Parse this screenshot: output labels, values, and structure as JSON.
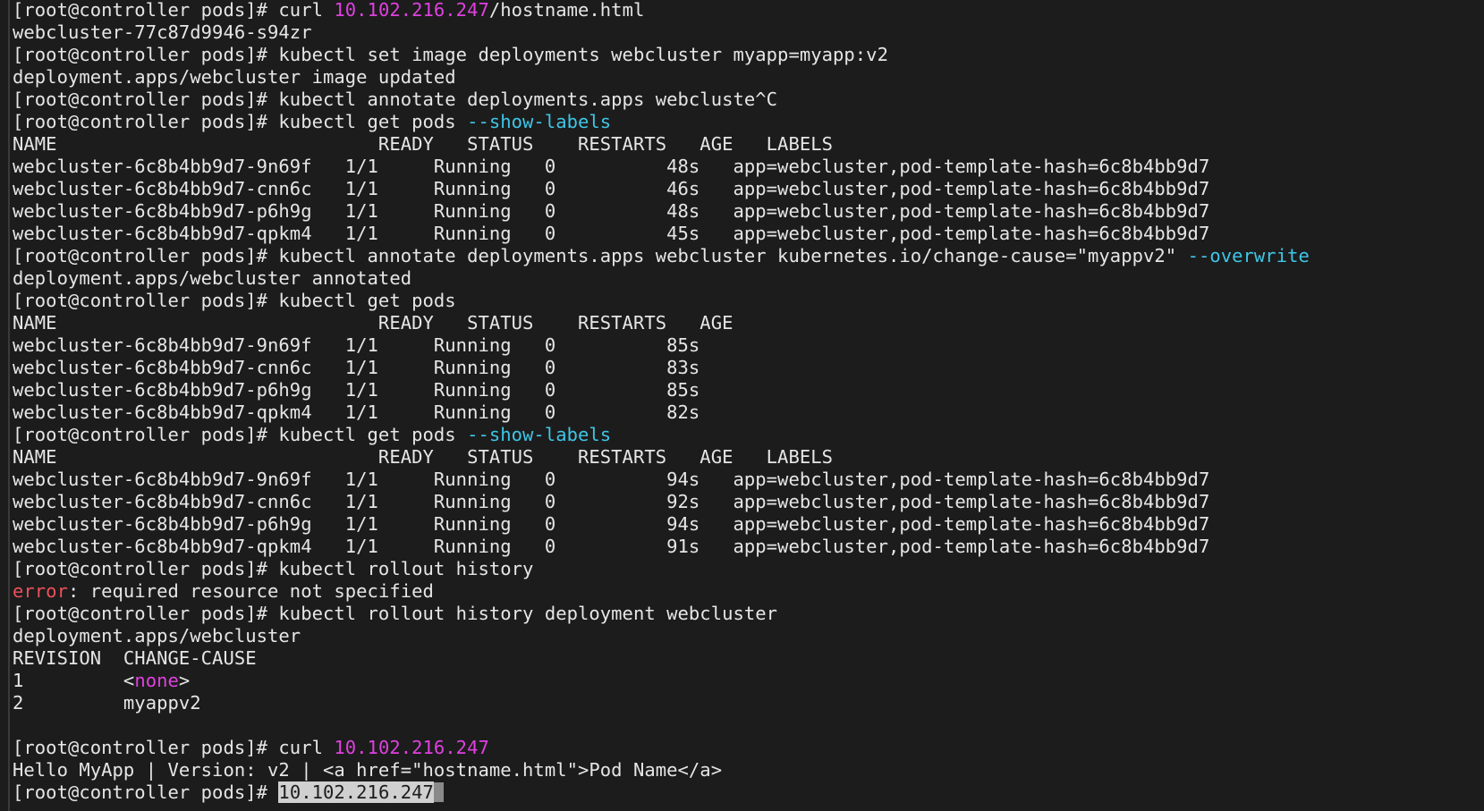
{
  "colors": {
    "background": "#1c1c1c",
    "text": "#e6e6e6",
    "ip_highlight": "#e040e0",
    "flag_highlight": "#3ec6e6",
    "error": "#f0505a",
    "selection": "#d0d0d0"
  },
  "terminal": {
    "lines": [
      {
        "segments": [
          {
            "t": "[root@controller pods]# curl "
          },
          {
            "t": "10.102.216.247",
            "c": "magenta"
          },
          {
            "t": "/hostname.html"
          }
        ]
      },
      {
        "segments": [
          {
            "t": "webcluster-77c87d9946-s94zr"
          }
        ]
      },
      {
        "segments": [
          {
            "t": "[root@controller pods]# kubectl set image deployments webcluster myapp=myapp:v2"
          }
        ]
      },
      {
        "segments": [
          {
            "t": "deployment.apps/webcluster image updated"
          }
        ]
      },
      {
        "segments": [
          {
            "t": "[root@controller pods]# kubectl annotate deployments.apps webcluste^C"
          }
        ]
      },
      {
        "segments": [
          {
            "t": "[root@controller pods]# kubectl get pods "
          },
          {
            "t": "--show-labels",
            "c": "cyan"
          }
        ]
      },
      {
        "segments": [
          {
            "t": "NAME                             READY   STATUS    RESTARTS   AGE   LABELS"
          }
        ]
      },
      {
        "segments": [
          {
            "t": "webcluster-6c8b4bb9d7-9n69f   1/1     Running   0          48s   app=webcluster,pod-template-hash=6c8b4bb9d7"
          }
        ]
      },
      {
        "segments": [
          {
            "t": "webcluster-6c8b4bb9d7-cnn6c   1/1     Running   0          46s   app=webcluster,pod-template-hash=6c8b4bb9d7"
          }
        ]
      },
      {
        "segments": [
          {
            "t": "webcluster-6c8b4bb9d7-p6h9g   1/1     Running   0          48s   app=webcluster,pod-template-hash=6c8b4bb9d7"
          }
        ]
      },
      {
        "segments": [
          {
            "t": "webcluster-6c8b4bb9d7-qpkm4   1/1     Running   0          45s   app=webcluster,pod-template-hash=6c8b4bb9d7"
          }
        ]
      },
      {
        "segments": [
          {
            "t": "[root@controller pods]# kubectl annotate deployments.apps webcluster kubernetes.io/change-cause=\"myappv2\" "
          },
          {
            "t": "--overwrite",
            "c": "cyan"
          }
        ]
      },
      {
        "segments": [
          {
            "t": "deployment.apps/webcluster annotated"
          }
        ]
      },
      {
        "segments": [
          {
            "t": "[root@controller pods]# kubectl get pods"
          }
        ]
      },
      {
        "segments": [
          {
            "t": "NAME                             READY   STATUS    RESTARTS   AGE"
          }
        ]
      },
      {
        "segments": [
          {
            "t": "webcluster-6c8b4bb9d7-9n69f   1/1     Running   0          85s"
          }
        ]
      },
      {
        "segments": [
          {
            "t": "webcluster-6c8b4bb9d7-cnn6c   1/1     Running   0          83s"
          }
        ]
      },
      {
        "segments": [
          {
            "t": "webcluster-6c8b4bb9d7-p6h9g   1/1     Running   0          85s"
          }
        ]
      },
      {
        "segments": [
          {
            "t": "webcluster-6c8b4bb9d7-qpkm4   1/1     Running   0          82s"
          }
        ]
      },
      {
        "segments": [
          {
            "t": "[root@controller pods]# kubectl get pods "
          },
          {
            "t": "--show-labels",
            "c": "cyan"
          }
        ]
      },
      {
        "segments": [
          {
            "t": "NAME                             READY   STATUS    RESTARTS   AGE   LABELS"
          }
        ]
      },
      {
        "segments": [
          {
            "t": "webcluster-6c8b4bb9d7-9n69f   1/1     Running   0          94s   app=webcluster,pod-template-hash=6c8b4bb9d7"
          }
        ]
      },
      {
        "segments": [
          {
            "t": "webcluster-6c8b4bb9d7-cnn6c   1/1     Running   0          92s   app=webcluster,pod-template-hash=6c8b4bb9d7"
          }
        ]
      },
      {
        "segments": [
          {
            "t": "webcluster-6c8b4bb9d7-p6h9g   1/1     Running   0          94s   app=webcluster,pod-template-hash=6c8b4bb9d7"
          }
        ]
      },
      {
        "segments": [
          {
            "t": "webcluster-6c8b4bb9d7-qpkm4   1/1     Running   0          91s   app=webcluster,pod-template-hash=6c8b4bb9d7"
          }
        ]
      },
      {
        "segments": [
          {
            "t": "[root@controller pods]# kubectl rollout history"
          }
        ]
      },
      {
        "segments": [
          {
            "t": "error",
            "c": "red"
          },
          {
            "t": ": required resource not specified"
          }
        ]
      },
      {
        "segments": [
          {
            "t": "[root@controller pods]# kubectl rollout history deployment webcluster"
          }
        ]
      },
      {
        "segments": [
          {
            "t": "deployment.apps/webcluster"
          }
        ]
      },
      {
        "segments": [
          {
            "t": "REVISION  CHANGE-CAUSE"
          }
        ]
      },
      {
        "segments": [
          {
            "t": "1         <"
          },
          {
            "t": "none",
            "c": "magenta"
          },
          {
            "t": ">"
          }
        ]
      },
      {
        "segments": [
          {
            "t": "2         myappv2"
          }
        ]
      },
      {
        "segments": [
          {
            "t": ""
          }
        ]
      },
      {
        "segments": [
          {
            "t": "[root@controller pods]# curl "
          },
          {
            "t": "10.102.216.247",
            "c": "magenta"
          }
        ]
      },
      {
        "segments": [
          {
            "t": "Hello MyApp | Version: v2 | <a href=\"hostname.html\">Pod Name</a>"
          }
        ]
      },
      {
        "segments": [
          {
            "t": "[root@controller pods]# "
          },
          {
            "t": "10.102.216.247",
            "c": "selected"
          },
          {
            "t": "",
            "c": "cursor"
          }
        ]
      }
    ]
  }
}
